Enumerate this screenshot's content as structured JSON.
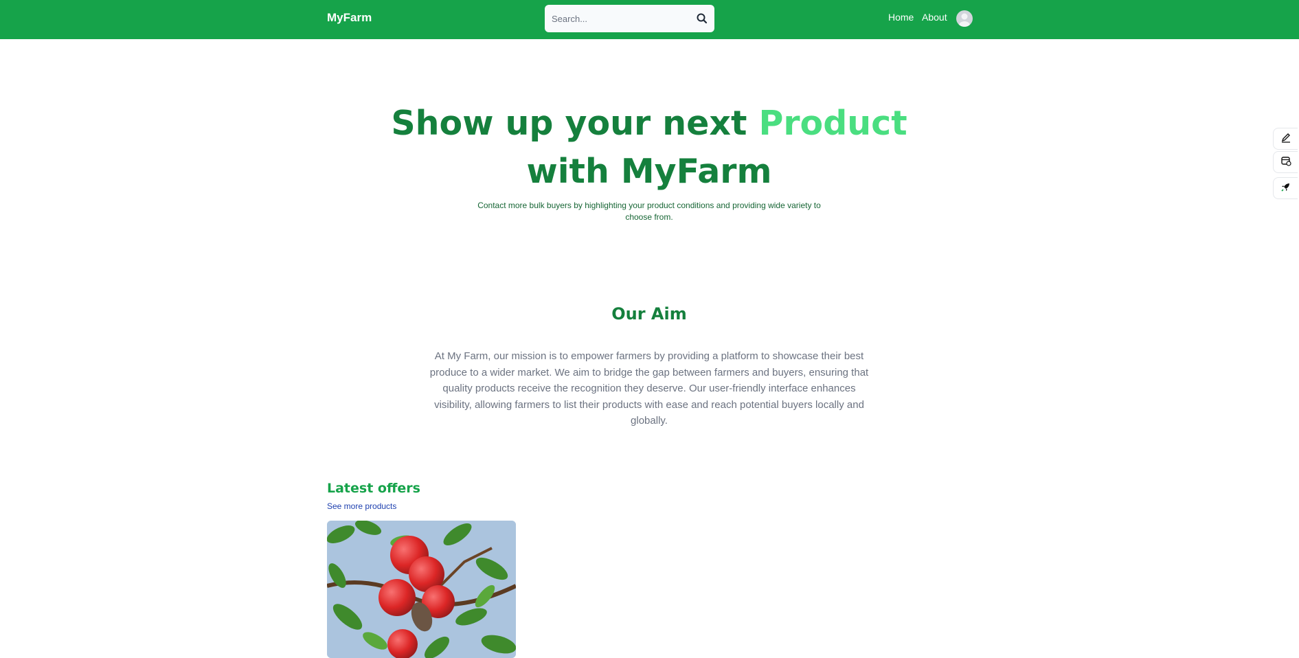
{
  "navbar": {
    "brand": "MyFarm",
    "search_placeholder": "Search...",
    "links": {
      "home": "Home",
      "about": "About"
    },
    "bg_color": "#16a34a"
  },
  "hero": {
    "title_part1": "Show up your next ",
    "title_highlight": "Product",
    "title_part2": "with MyFarm",
    "subtitle": "Contact more bulk buyers by highlighting your product conditions and providing wide variety to choose from."
  },
  "aim": {
    "title": "Our Aim",
    "text": "At My Farm, our mission is to empower farmers by providing a platform to showcase their best produce to a wider market. We aim to bridge the gap between farmers and buyers, ensuring that quality products receive the recognition they deserve. Our user-friendly interface enhances visibility, allowing farmers to list their products with ease and reach potential buyers locally and globally."
  },
  "offers": {
    "title": "Latest offers",
    "see_more": "See more products",
    "items": [
      {
        "image": "apples-on-tree-photo"
      }
    ]
  },
  "side_tools": [
    "edit-icon",
    "calendar-icon",
    "rocket-icon"
  ]
}
